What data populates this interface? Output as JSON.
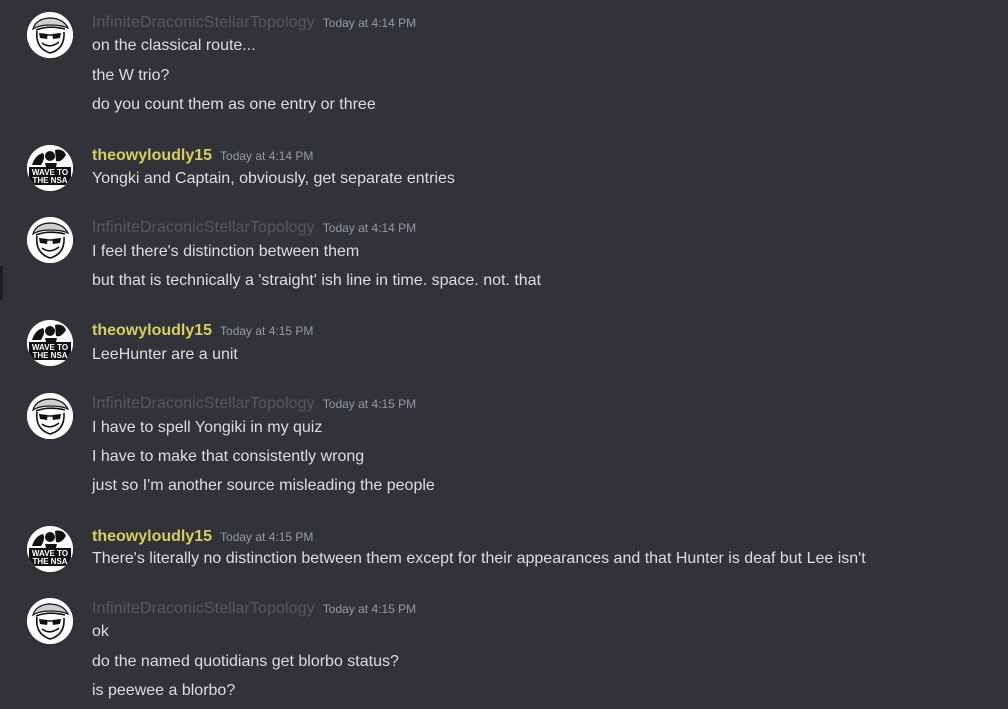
{
  "users": {
    "infinite": "InfiniteDraconicStellarTopology",
    "theowy": "theowyloudly15"
  },
  "colors": {
    "background": "#313338",
    "text": "#dbdee1",
    "timestamp": "#949ba4",
    "infinite_name": "#5a5759",
    "theowy_name": "#d6cd63"
  },
  "theowy_avatar_text": [
    "WAVE TO",
    "THE NSA"
  ],
  "messages": [
    {
      "author": "InfiniteDraconicStellarTopology",
      "timestamp": "Today at 4:14 PM",
      "lines": [
        "on the classical route...",
        "the W trio?",
        "do you count them as one entry or three"
      ]
    },
    {
      "author": "theowyloudly15",
      "timestamp": "Today at 4:14 PM",
      "lines": [
        "Yongki and Captain, obviously, get separate entries"
      ]
    },
    {
      "author": "InfiniteDraconicStellarTopology",
      "timestamp": "Today at 4:14 PM",
      "lines": [
        "I feel there's distinction between them",
        "but that is technically a 'straight' ish line in time. space. not. that"
      ]
    },
    {
      "author": "theowyloudly15",
      "timestamp": "Today at 4:15 PM",
      "lines": [
        "LeeHunter are a unit"
      ]
    },
    {
      "author": "InfiniteDraconicStellarTopology",
      "timestamp": "Today at 4:15 PM",
      "lines": [
        "I have to spell Yongiki in my quiz",
        "I have to make that consistently wrong",
        "just so I'm another source misleading the people"
      ]
    },
    {
      "author": "theowyloudly15",
      "timestamp": "Today at 4:15 PM",
      "lines": [
        "There's literally no distinction between them except for their appearances and that Hunter is deaf but Lee isn't"
      ]
    },
    {
      "author": "InfiniteDraconicStellarTopology",
      "timestamp": "Today at 4:15 PM",
      "lines": [
        "ok",
        "do the named quotidians get blorbo status?",
        "is peewee a blorbo?"
      ]
    }
  ]
}
